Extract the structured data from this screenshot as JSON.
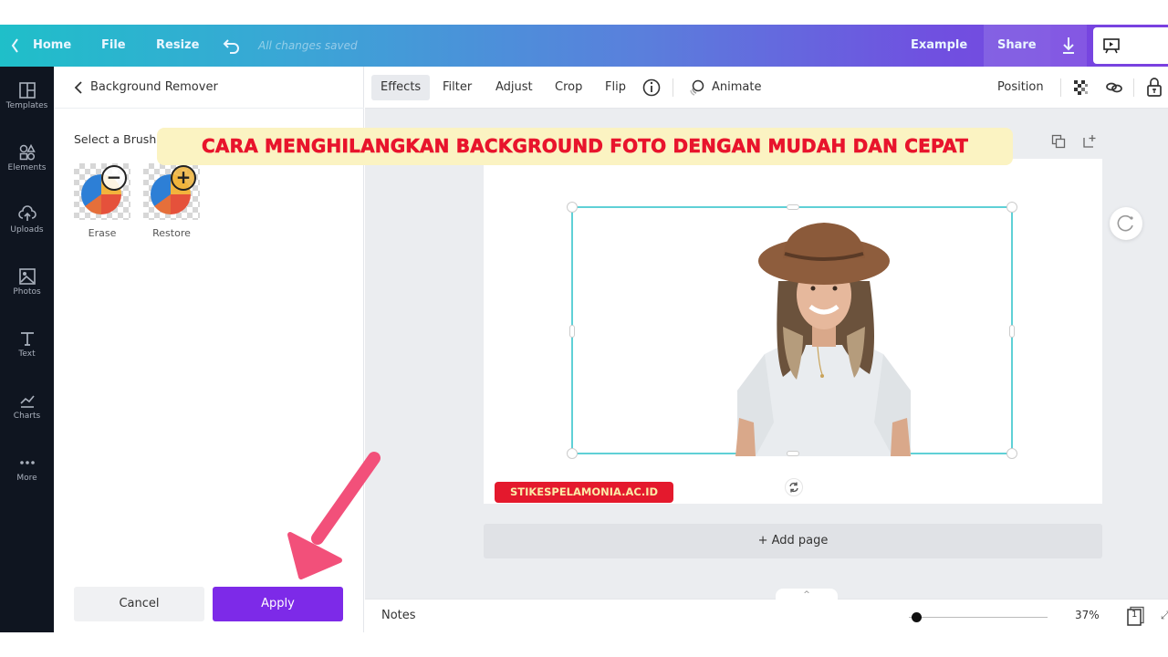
{
  "topbar": {
    "home": "Home",
    "file": "File",
    "resize": "Resize",
    "saved_status": "All changes saved",
    "design_name": "Example",
    "share": "Share",
    "present": "Present"
  },
  "rail": {
    "items": [
      {
        "label": "Templates",
        "icon": "templates-icon"
      },
      {
        "label": "Elements",
        "icon": "elements-icon"
      },
      {
        "label": "Uploads",
        "icon": "uploads-icon"
      },
      {
        "label": "Photos",
        "icon": "photos-icon"
      },
      {
        "label": "Text",
        "icon": "text-icon"
      },
      {
        "label": "Charts",
        "icon": "charts-icon"
      },
      {
        "label": "More",
        "icon": "more-icon"
      }
    ]
  },
  "panel": {
    "title": "Background Remover",
    "select_label": "Select a Brush",
    "brushes": [
      {
        "label": "Erase",
        "symbol": "−"
      },
      {
        "label": "Restore",
        "symbol": "+"
      }
    ],
    "cancel": "Cancel",
    "apply": "Apply"
  },
  "toolbar": {
    "effects": "Effects",
    "filter": "Filter",
    "adjust": "Adjust",
    "crop": "Crop",
    "flip": "Flip",
    "animate": "Animate",
    "position": "Position"
  },
  "canvas": {
    "add_page": "+ Add page"
  },
  "footer": {
    "notes": "Notes",
    "zoom": "37%",
    "zoom_fraction": 0.37,
    "page_count": "1"
  },
  "overlay": {
    "headline": "CARA MENGHILANGKAN BACKGROUND FOTO DENGAN MUDAH DAN CEPAT",
    "watermark": "STIKESPELAMONIA.AC.ID"
  },
  "colors": {
    "accent_purple": "#7d2ae8",
    "selection_teal": "#5fd0d6",
    "headline_red": "#e8142c",
    "headline_bg": "#fbf3c2",
    "arrow_pink": "#f2507a"
  }
}
